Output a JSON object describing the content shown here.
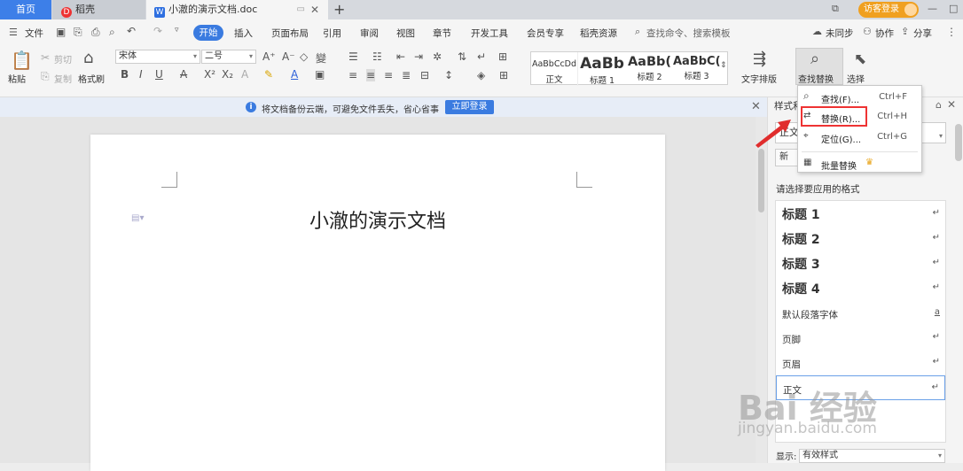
{
  "tabs": {
    "home": "首页",
    "daoke": "稻壳",
    "doc": "小澈的演示文档.doc",
    "plus": "+"
  },
  "title_right": {
    "login": "访客登录"
  },
  "menubar": {
    "file": "文件",
    "items": [
      "开始",
      "插入",
      "页面布局",
      "引用",
      "审阅",
      "视图",
      "章节",
      "开发工具",
      "会员专享",
      "稻壳资源"
    ],
    "search": "查找命令、搜索模板",
    "sync": "未同步",
    "collab": "协作",
    "share": "分享"
  },
  "ribbon": {
    "paste": "粘贴",
    "cut": "剪切",
    "copy": "复制",
    "format_brush": "格式刷",
    "font_name": "宋体",
    "font_size": "二号",
    "styles": [
      {
        "preview": "AaBbCcDd",
        "name": "正文"
      },
      {
        "preview": "AaBb",
        "name": "标题 1"
      },
      {
        "preview": "AaBb(",
        "name": "标题 2"
      },
      {
        "preview": "AaBbC(",
        "name": "标题 3"
      }
    ],
    "text_layout": "文字排版",
    "find_replace": "查找替换",
    "select": "选择"
  },
  "infobar": {
    "text": "将文档备份云端，可避免文件丢失，省心省事",
    "button": "立即登录"
  },
  "document": {
    "title": "小澈的演示文档"
  },
  "find_menu": {
    "items": [
      {
        "label": "查找(F)...",
        "shortcut": "Ctrl+F"
      },
      {
        "label": "替换(R)...",
        "shortcut": "Ctrl+H"
      },
      {
        "label": "定位(G)...",
        "shortcut": "Ctrl+G"
      },
      {
        "label": "批量替换",
        "shortcut": ""
      }
    ]
  },
  "styles_pane": {
    "title": "样式和",
    "current": "正文",
    "new_button": "新",
    "prompt": "请选择要应用的格式",
    "list": [
      {
        "name": "标题  1",
        "mark": "↵"
      },
      {
        "name": "标题  2",
        "mark": "↵"
      },
      {
        "name": "标题  3",
        "mark": "↵"
      },
      {
        "name": "标题  4",
        "mark": "↵"
      },
      {
        "name": "默认段落字体",
        "mark": "a"
      },
      {
        "name": "页脚",
        "mark": "↵"
      },
      {
        "name": "页眉",
        "mark": "↵"
      },
      {
        "name": "正文",
        "mark": "↵"
      }
    ],
    "show_label": "显示:",
    "show_value": "有效样式"
  },
  "watermark": {
    "brand": "Bai 经验",
    "url": "jingyan.baidu.com"
  },
  "colors": {
    "accent": "#3a7be0",
    "highlight": "#e33333",
    "login": "#f0a020"
  }
}
